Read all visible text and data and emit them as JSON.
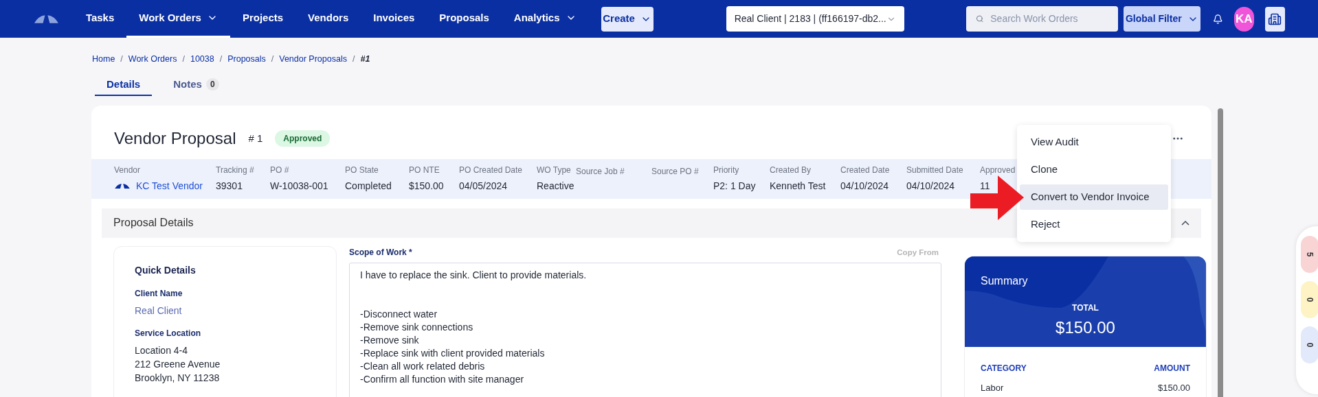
{
  "nav": {
    "items": [
      {
        "label": "Tasks",
        "dropdown": false,
        "selected": false
      },
      {
        "label": "Work Orders",
        "dropdown": true,
        "selected": true
      },
      {
        "label": "Projects",
        "dropdown": false,
        "selected": false
      },
      {
        "label": "Vendors",
        "dropdown": false,
        "selected": false
      },
      {
        "label": "Invoices",
        "dropdown": false,
        "selected": false
      },
      {
        "label": "Proposals",
        "dropdown": false,
        "selected": false
      },
      {
        "label": "Analytics",
        "dropdown": true,
        "selected": false
      }
    ],
    "create": "Create",
    "client_select": "Real Client | 2183 | (ff166197-db2...",
    "search": {
      "placeholder": "Search Work Orders"
    },
    "global_filter": "Global Filter",
    "avatar": "KA"
  },
  "breadcrumb": {
    "separator": "/",
    "items": [
      {
        "label": "Home",
        "current": false
      },
      {
        "label": "Work Orders",
        "current": false
      },
      {
        "label": "10038",
        "current": false
      },
      {
        "label": "Proposals",
        "current": false
      },
      {
        "label": "Vendor Proposals",
        "current": false
      },
      {
        "label": "#1",
        "current": true
      }
    ]
  },
  "tabs": [
    {
      "label": "Details",
      "selected": true
    },
    {
      "label": "Notes",
      "count": "0",
      "selected": false
    }
  ],
  "header": {
    "title": "Vendor Proposal",
    "number": "# 1",
    "status": "Approved"
  },
  "info": [
    {
      "label": "Vendor",
      "value": "KC Test Vendor",
      "kind": "link"
    },
    {
      "label": "Tracking #",
      "value": "39301",
      "kind": "text"
    },
    {
      "label": "PO #",
      "value": "W-10038-001",
      "kind": "text"
    },
    {
      "label": "PO State",
      "value": "Completed",
      "kind": "text"
    },
    {
      "label": "PO NTE",
      "value": "$150.00",
      "kind": "text"
    },
    {
      "label": "PO Created Date",
      "value": "04/05/2024",
      "kind": "text"
    },
    {
      "label": "WO Type",
      "value": "Reactive",
      "kind": "text"
    },
    {
      "label": "Source Job #",
      "kind": "text"
    },
    {
      "label": "Source PO #",
      "kind": "text"
    },
    {
      "label": "Priority",
      "value": "P2: 1 Day",
      "kind": "text"
    },
    {
      "label": "Created By",
      "value": "Kenneth Test",
      "kind": "text"
    },
    {
      "label": "Created Date",
      "value": "04/10/2024",
      "kind": "text"
    },
    {
      "label": "Submitted Date",
      "value": "04/10/2024",
      "kind": "text"
    },
    {
      "label": "Approved",
      "value": "11",
      "kind": "text"
    }
  ],
  "actions_menu": [
    {
      "label": "View Audit",
      "selected": false
    },
    {
      "label": "Clone",
      "selected": false
    },
    {
      "label": "Convert to Vendor Invoice",
      "selected": true
    },
    {
      "label": "Reject",
      "selected": false
    }
  ],
  "section": {
    "title": "Proposal Details",
    "expanded": true
  },
  "quick_details": {
    "title": "Quick Details",
    "fields": [
      {
        "label": "Client Name",
        "lines": [
          "Real Client"
        ],
        "kind": "link"
      },
      {
        "label": "Service Location",
        "lines": [
          "Location 4-4",
          "212 Greene Avenue",
          "Brooklyn, NY 11238"
        ],
        "kind": "text"
      }
    ]
  },
  "scope": {
    "label": "Scope of Work *",
    "copy_from": "Copy From",
    "value": "I have to replace the sink. Client to provide materials.\n\n\n-Disconnect water\n-Remove sink connections\n-Remove sink\n-Replace sink with client provided materials\n-Clean all work related debris\n-Confirm all function with site manager"
  },
  "summary": {
    "title": "Summary",
    "total_label": "TOTAL",
    "total": "$150.00",
    "columns": [
      "CATEGORY",
      "AMOUNT"
    ],
    "rows": [
      [
        "Labor",
        "$150.00"
      ]
    ]
  },
  "side_counters": [
    {
      "value": "5",
      "color": "#f8d4d4"
    },
    {
      "value": "0",
      "color": "#fdf3c4"
    },
    {
      "value": "0",
      "color": "#e1e9fb"
    }
  ]
}
